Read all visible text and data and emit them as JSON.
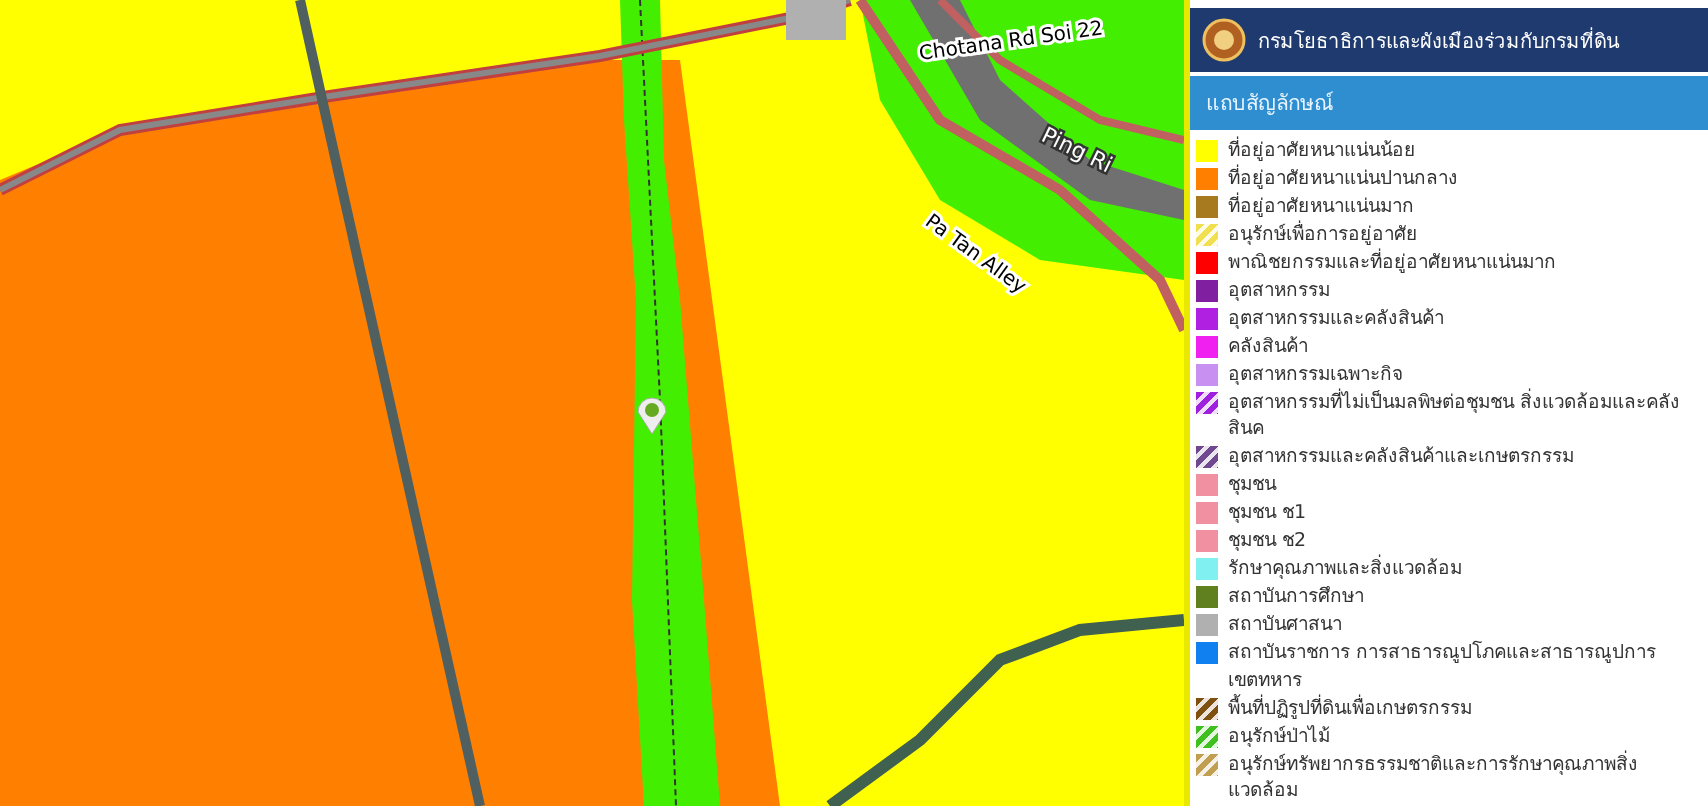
{
  "map": {
    "labels": [
      {
        "text": "Chotana Rd Soi 22",
        "kind": "road"
      },
      {
        "text": "Pa Tan Alley",
        "kind": "road"
      },
      {
        "text": "Ping Ri",
        "kind": "water"
      }
    ]
  },
  "header": {
    "title": "กรมโยธาธิการและผังเมืองร่วมกับกรมที่ดิน"
  },
  "legend": {
    "title": "แถบสัญลักษณ์",
    "items": [
      {
        "label": "ที่อยู่อาศัยหนาแน่นน้อย",
        "kind": "solid",
        "color": "#ffff00"
      },
      {
        "label": "ที่อยู่อาศัยหนาแน่นปานกลาง",
        "kind": "solid",
        "color": "#ff8000"
      },
      {
        "label": "ที่อยู่อาศัยหนาแน่นมาก",
        "kind": "solid",
        "color": "#a87a20"
      },
      {
        "label": "อนุรักษ์เพื่อการอยู่อาศัย",
        "kind": "hatch",
        "color": "#f0e050"
      },
      {
        "label": "พาณิชยกรรมและที่อยู่อาศัยหนาแน่นมาก",
        "kind": "solid",
        "color": "#ff0000"
      },
      {
        "label": "อุตสาหกรรม",
        "kind": "solid",
        "color": "#8020a0"
      },
      {
        "label": "อุตสาหกรรมและคลังสินค้า",
        "kind": "solid",
        "color": "#b020e0"
      },
      {
        "label": "คลังสินค้า",
        "kind": "solid",
        "color": "#f020f0"
      },
      {
        "label": "อุตสาหกรรมเฉพาะกิจ",
        "kind": "solid",
        "color": "#c890f0"
      },
      {
        "label": "อุตสาหกรรมที่ไม่เป็นมลพิษต่อชุมชน สิ่งแวดล้อมและคลังสินค",
        "kind": "hatch",
        "color": "#a020e0"
      },
      {
        "label": "อุตสาหกรรมและคลังสินค้าและเกษตรกรรม",
        "kind": "hatch",
        "color": "#704890"
      },
      {
        "label": "ชุมชน",
        "kind": "solid",
        "color": "#f090a0"
      },
      {
        "label": "ชุมชน  ช1",
        "kind": "solid",
        "color": "#f090a0"
      },
      {
        "label": "ชุมชน  ช2",
        "kind": "solid",
        "color": "#f090a0"
      },
      {
        "label": "รักษาคุณภาพและสิ่งแวดล้อม",
        "kind": "solid",
        "color": "#80f0f0"
      },
      {
        "label": "สถาบันการศึกษา",
        "kind": "solid",
        "color": "#608020"
      },
      {
        "label": "สถาบันศาสนา",
        "kind": "solid",
        "color": "#b0b0b0"
      },
      {
        "label": "สถาบันราชการ การสาธารณูปโภคและสาธารณูปการ",
        "kind": "solid",
        "color": "#1080f0"
      },
      {
        "label": "เขตทหาร",
        "kind": "empty"
      },
      {
        "label": "พื้นที่ปฏิรูปที่ดินเพื่อเกษตรกรรม",
        "kind": "hatch",
        "color": "#805010"
      },
      {
        "label": "อนุรักษ์ป่าไม้",
        "kind": "hatch",
        "color": "#40c020"
      },
      {
        "label": "อนุรักษ์ทรัพยากรธรรมชาติและการรักษาคุณภาพสิ่งแวดล้อม",
        "kind": "hatch",
        "color": "#c0a050"
      }
    ]
  }
}
